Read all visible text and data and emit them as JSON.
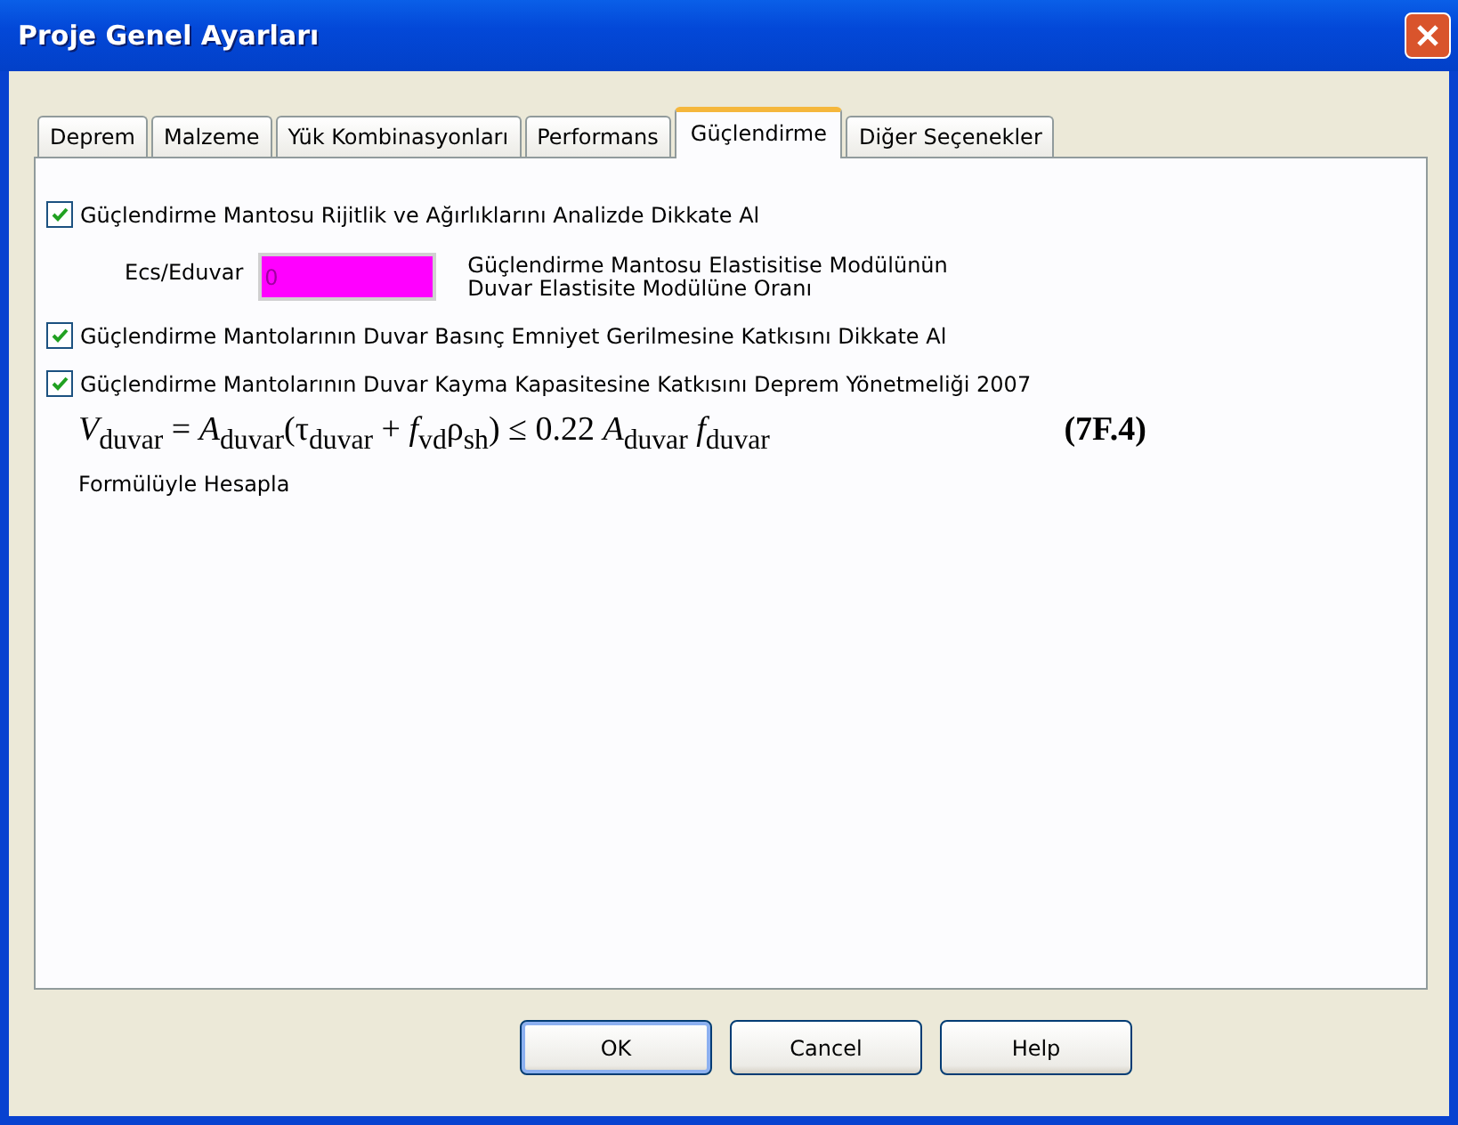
{
  "window": {
    "title": "Proje Genel Ayarları"
  },
  "tabs": [
    {
      "label": "Deprem",
      "selected": false
    },
    {
      "label": "Malzeme",
      "selected": false
    },
    {
      "label": "Yük Kombinasyonları",
      "selected": false
    },
    {
      "label": "Performans",
      "selected": false
    },
    {
      "label": "Güçlendirme",
      "selected": true
    },
    {
      "label": "Diğer Seçenekler",
      "selected": false
    }
  ],
  "options": [
    {
      "kind": "checkbox",
      "label": "Güçlendirme Mantosu Rijitlik ve Ağırlıklarını Analizde Dikkate Al",
      "checked": true
    },
    {
      "kind": "ratio",
      "label": "Ecs/Eduvar",
      "value": "0",
      "description": "Güçlendirme Mantosu Elastisitise Modülünün\nDuvar Elastisite Modülüne Oranı"
    },
    {
      "kind": "checkbox",
      "label": "Güçlendirme Mantolarının Duvar Basınç Emniyet Gerilmesine Katkısını Dikkate Al",
      "checked": true
    },
    {
      "kind": "checkbox",
      "label": "Güçlendirme Mantolarının Duvar Kayma Kapasitesine Katkısını Deprem Yönetmeliği 2007",
      "checked": true
    },
    {
      "kind": "formula",
      "formula": "*V*$_{duvar}$ = *A*$_{duvar}$(τ$_{duvar}$  + *f*$_{vd}$ρ$_{sh}$) ≤ 0.22 *A*$_{duvar}$ *f*$_{duvar}$",
      "number": "(7F.4)"
    },
    {
      "kind": "text",
      "text": "Formülüyle Hesapla"
    }
  ],
  "buttons": [
    {
      "label": "OK",
      "default": true
    },
    {
      "label": "Cancel",
      "default": false
    },
    {
      "label": "Help",
      "default": false
    }
  ]
}
